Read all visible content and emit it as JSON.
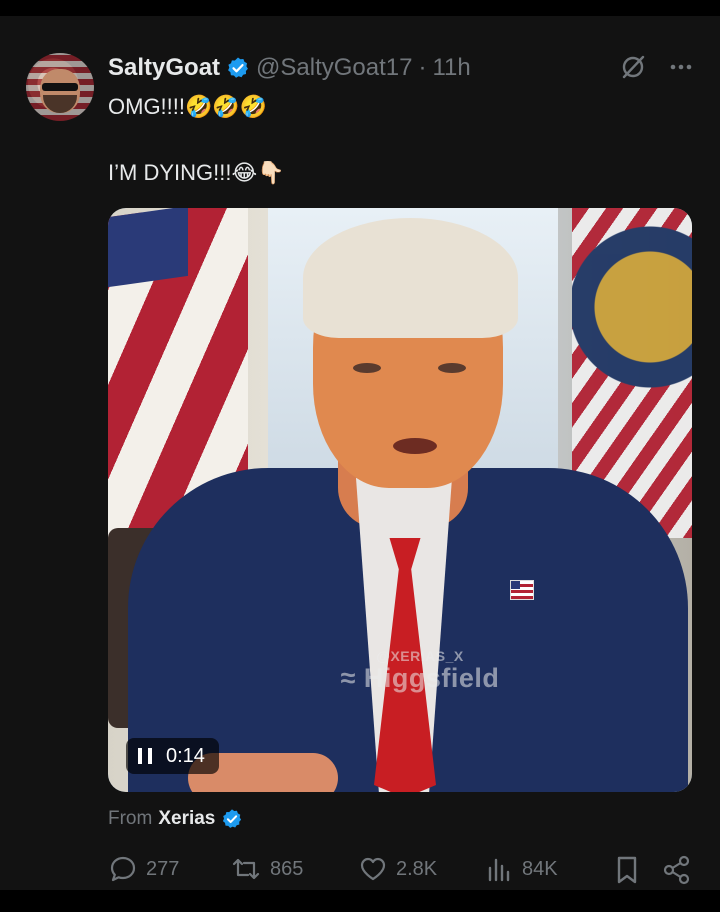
{
  "post": {
    "author_name": "SaltyGoat",
    "author_handle": "@SaltyGoat17",
    "separator": "·",
    "time": "11h",
    "text_line1": "OMG!!!!",
    "text_line1_emoji": "🤣🤣🤣",
    "text_line2": "I’M DYING!!!",
    "text_line2_emoji": "😂👇🏻"
  },
  "media": {
    "watermark_handle": "@XERIAS_X",
    "watermark_brand": "Higgsfield",
    "playback_time": "0:14",
    "state": "playing"
  },
  "source": {
    "prefix": "From",
    "name": "Xerias"
  },
  "actions": {
    "replies": "277",
    "reposts": "865",
    "likes": "2.8K",
    "views": "84K"
  },
  "colors": {
    "background": "#000000",
    "card": "#121212",
    "text": "#e7e9ea",
    "muted": "#71767b",
    "verified": "#1d9bf0"
  }
}
